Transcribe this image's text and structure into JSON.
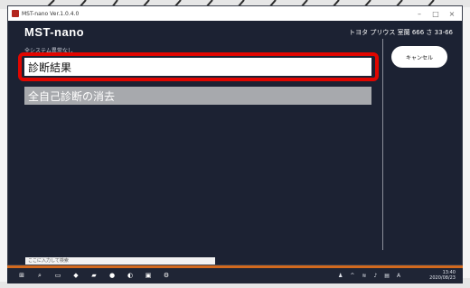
{
  "window": {
    "title": "MST-nano Ver.1.0.4.0"
  },
  "header": {
    "app_name": "MST-nano",
    "vehicle": "トヨタ プリウス 室蘭 666 さ 33-66"
  },
  "status_text": "全システム異常なし",
  "menu": [
    {
      "label": "診断結果"
    },
    {
      "label": "全自己診断の消去"
    }
  ],
  "cancel_label": "キャンセル",
  "taskbar": {
    "search_placeholder": "ここに入力して検索",
    "clock_time": "13:40",
    "clock_date": "2020/08/23"
  },
  "colors": {
    "window_bg": "#1c2233",
    "highlight": "#e10600",
    "menu_selected": "#ffffff",
    "menu_secondary": "#a7a9ad"
  }
}
